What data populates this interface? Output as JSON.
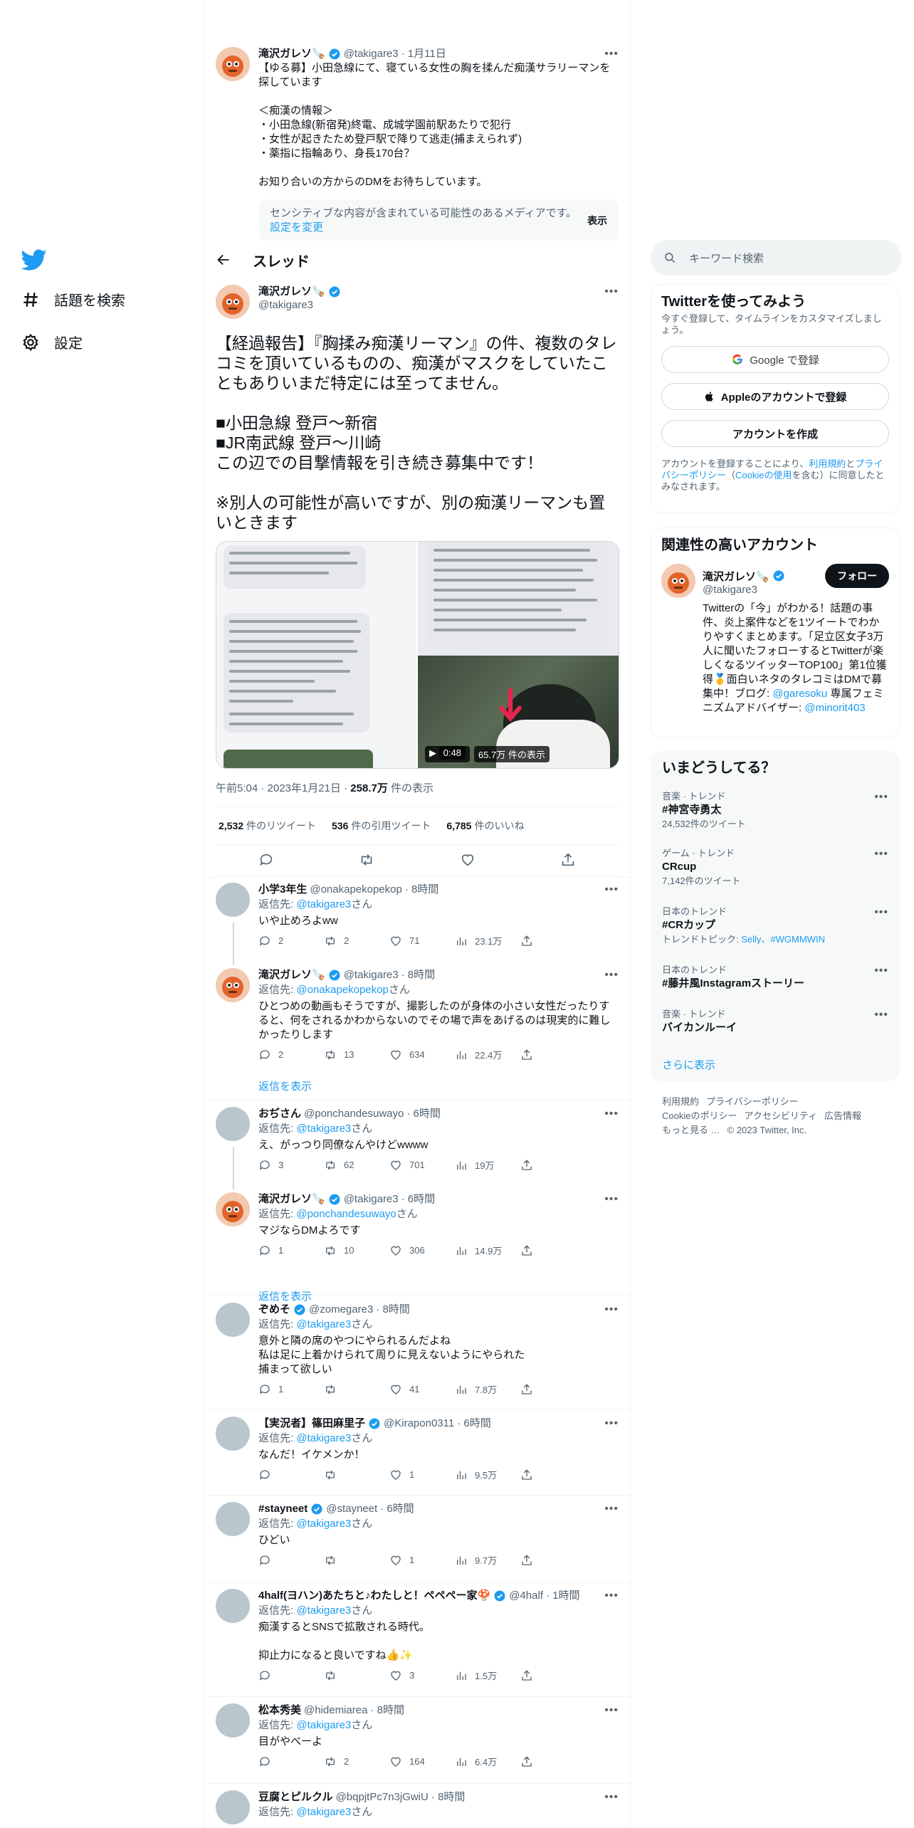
{
  "nav": {
    "explore_label": "話題を検索",
    "settings_label": "設定"
  },
  "prev_tweet": {
    "name": "滝沢ガレソ🪚",
    "handle": "@takigare3",
    "time": "· 1月11日",
    "text": "【ゆる募】小田急線にて、寝ている女性の胸を揉んだ痴漢サラリーマンを探しています\n\n＜痴漢の情報＞\n・小田急線(新宿発)終電、成城学園前駅あたりで犯行\n・女性が起きたため登戸駅で降りて逃走(捕まえられず)\n・薬指に指輪あり、身長170台？\n\nお知り合いの方からのDMをお待ちしています。",
    "sensitive_text": "センシティブな内容が含まれている可能性のあるメディアです。",
    "sensitive_link": "設定を変更",
    "show_label": "表示"
  },
  "thread": {
    "title": "スレッド"
  },
  "main_tweet": {
    "name": "滝沢ガレソ🪚",
    "handle": "@takigare3",
    "text": "【経過報告】『胸揉み痴漢リーマン』の件、複数のタレコミを頂いているものの、痴漢がマスクをしていたこともありいまだ特定には至ってません。\n\n■小田急線 登戸～新宿\n■JR南武線 登戸～川崎\nこの辺での目撃情報を引き続き募集中です！\n\n※別人の可能性が高いですが、別の痴漢リーマンも置いときます",
    "video_duration": "0:48",
    "video_views": "65.7万 件の表示",
    "time": "午前5:04 · 2023年1月21日 · ",
    "views_num": "258.7万",
    "views_label": " 件の表示",
    "retweets": "2,532",
    "retweets_label": "件のリツイート",
    "quotes": "536",
    "quotes_label": "件の引用ツイート",
    "likes": "6,785",
    "likes_label": "件のいいね"
  },
  "replies": [
    {
      "name": "小学3年生",
      "handle": "@onakapekopekop",
      "time": "· 8時間",
      "to": "@takigare3",
      "text": "いや止めろよww",
      "replies": "2",
      "retweets": "2",
      "likes": "71",
      "views": "23.1万"
    },
    {
      "name": "滝沢ガレソ🪚",
      "handle": "@takigare3",
      "time": "· 8時間",
      "to": "@onakapekopekop",
      "text": "ひとつめの動画もそうですが、撮影したのが身体の小さい女性だったりすると、何をされるかわからないのでその場で声をあげるのは現実的に難しかったりします",
      "replies": "2",
      "retweets": "13",
      "likes": "634",
      "views": "22.4万"
    },
    {
      "name": "おぢさん",
      "handle": "@ponchandesuwayo",
      "time": "· 6時間",
      "to": "@takigare3",
      "text": "え、がっつり同僚なんやけどwwww",
      "replies": "3",
      "retweets": "62",
      "likes": "701",
      "views": "19万"
    },
    {
      "name": "滝沢ガレソ🪚",
      "handle": "@takigare3",
      "time": "· 6時間",
      "to": "@ponchandesuwayo",
      "text": "マジならDMよろです",
      "replies": "1",
      "retweets": "10",
      "likes": "306",
      "views": "14.9万"
    },
    {
      "name": "ぞめそ",
      "handle": "@zomegare3",
      "time": "· 8時間",
      "to": "@takigare3",
      "text": "意外と隣の席のやつにやられるんだよね\n私は足に上着かけられて周りに見えないようにやられた\n捕まって欲しい",
      "replies": "1",
      "retweets": "",
      "likes": "41",
      "views": "7.8万"
    },
    {
      "name": "【実況者】篠田麻里子",
      "handle": "@Kirapon0311",
      "time": "· 6時間",
      "to": "@takigare3",
      "text": "なんだ！イケメンか！",
      "replies": "",
      "retweets": "",
      "likes": "1",
      "views": "9.5万"
    },
    {
      "name": "#stayneet",
      "handle": "@stayneet",
      "time": "· 6時間",
      "to": "@takigare3",
      "text": "ひどい",
      "replies": "",
      "retweets": "",
      "likes": "1",
      "views": "9.7万"
    },
    {
      "name": "4half(ヨハン)あたちと♪わたしと！ペペペー家🍄",
      "handle": "@4half",
      "time": "· 1時間",
      "to": "@takigare3",
      "text": "痴漢するとSNSで拡散される時代。\n\n抑止力になると良いですね👍✨",
      "replies": "",
      "retweets": "",
      "likes": "3",
      "views": "1.5万"
    },
    {
      "name": "松本秀美",
      "handle": "@hidemiarea",
      "time": "· 8時間",
      "to": "@takigare3",
      "text": "目がやべーよ",
      "replies": "",
      "retweets": "2",
      "likes": "164",
      "views": "6.4万"
    },
    {
      "name": "豆腐とピルクル",
      "handle": "@bqpjtPc7n3jGwiU",
      "time": "· 8時間",
      "to": "@takigare3",
      "text": "",
      "replies": "",
      "retweets": "",
      "likes": "",
      "views": ""
    }
  ],
  "common": {
    "reply_to_prefix": "返信先: ",
    "reply_to_suffix": "さん",
    "show_replies": "返信を表示"
  },
  "sidebar": {
    "search_placeholder": "キーワード検索",
    "signup": {
      "title": "Twitterを使ってみよう",
      "subtitle": "今すぐ登録して、タイムラインをカスタマイズしましょう。",
      "google_btn": "Google で登録",
      "apple_btn": "Appleのアカウントで登録",
      "create_btn": "アカウントを作成",
      "terms_1": "アカウントを登録することにより、",
      "terms_link1": "利用規約",
      "terms_2": "と",
      "terms_link2": "プライバシーポリシー",
      "terms_3": "（",
      "terms_link3": "Cookieの使用",
      "terms_4": "を含む）に同意したとみなされます。"
    },
    "related": {
      "title": "関連性の高いアカウント",
      "name": "滝沢ガレソ🪚",
      "handle": "@takigare3",
      "follow_btn": "フォロー",
      "bio": "Twitterの「今」がわかる！話題の事件、炎上案件などを1ツイートでわかりやすくまとめます。「足立区女子3万人に聞いたフォローするとTwitterが楽しくなるツイッターTOP100」第1位獲得🥇面白いネタのタレコミはDMで募集中！ブログ: ",
      "bio_link1": "@garesoku",
      "bio_2": " 専属フェミニズムアドバイザー: ",
      "bio_link2": "@minorit403"
    },
    "trends": {
      "title": "いまどうしてる？",
      "items": [
        {
          "category": "音楽 · トレンド",
          "title": "#神宮寺勇太",
          "sub": "24,532件のツイート",
          "sub_link": ""
        },
        {
          "category": "ゲーム · トレンド",
          "title": "CRcup",
          "sub": "7,142件のツイート",
          "sub_link": ""
        },
        {
          "category": "日本のトレンド",
          "title": "#CRカップ",
          "sub": "トレンドトピック: ",
          "sub_link": "Selly、#WGMMWIN"
        },
        {
          "category": "日本のトレンド",
          "title": "#藤井風Instagramストーリー",
          "sub": "",
          "sub_link": ""
        },
        {
          "category": "音楽 · トレンド",
          "title": "バイカンルーイ",
          "sub": "",
          "sub_link": ""
        }
      ],
      "show_more": "さらに表示"
    },
    "footer": {
      "items": [
        "利用規約",
        "プライバシーポリシー",
        "Cookieのポリシー",
        "アクセシビリティ",
        "広告情報",
        "もっと見る …",
        "© 2023 Twitter, Inc."
      ]
    }
  },
  "colors": {
    "accent": "#1d9bf0",
    "text": "#0f1419",
    "muted": "#536471",
    "border": "#eff3f4"
  }
}
